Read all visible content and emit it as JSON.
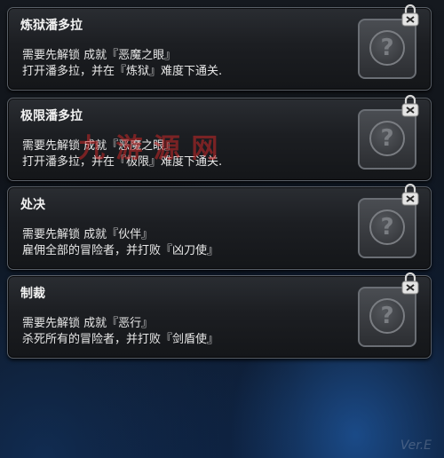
{
  "cards": [
    {
      "title": "炼狱潘多拉",
      "line1": "需要先解锁 成就『恶魔之眼』",
      "line2": "打开潘多拉，并在『炼狱』难度下通关."
    },
    {
      "title": "极限潘多拉",
      "line1": "需要先解锁 成就『恶魔之眼』",
      "line2": "打开潘多拉，并在『极限』难度下通关."
    },
    {
      "title": "处决",
      "line1": "需要先解锁 成就『伙伴』",
      "line2": "雇佣全部的冒险者，并打败『凶刀使』"
    },
    {
      "title": "制裁",
      "line1": "需要先解锁 成就『恶行』",
      "line2": "杀死所有的冒险者，并打败『剑盾使』"
    }
  ],
  "icon": {
    "symbol": "?",
    "name": "question-mark-icon",
    "lock": "padlock-icon"
  },
  "watermark": "九 游 源 网",
  "version": "Ver.E",
  "colors": {
    "text": "#e8e8e8",
    "accent_glow": "#2878dc",
    "watermark": "#c82828"
  }
}
